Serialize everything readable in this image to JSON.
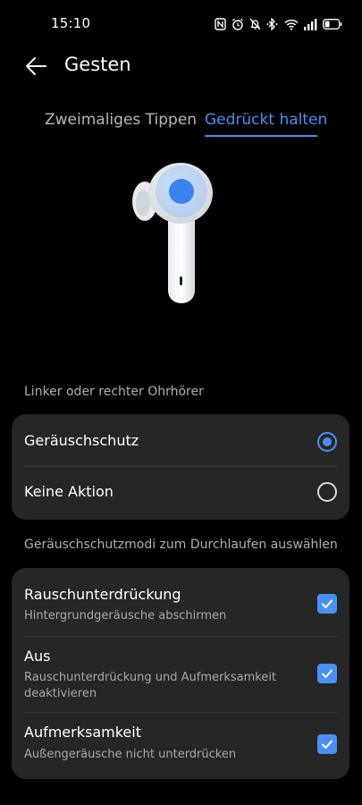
{
  "status_bar": {
    "time": "15:10",
    "icons": [
      "nfc-icon",
      "alarm-icon",
      "mute-icon",
      "bluetooth-icon",
      "wifi-icon",
      "signal-icon",
      "battery-icon"
    ]
  },
  "header": {
    "title": "Gesten",
    "back_icon": "arrow-left-icon"
  },
  "tabs": [
    {
      "label": "Zweimaliges Tippen",
      "selected": false
    },
    {
      "label": "Gedrückt halten",
      "selected": true
    }
  ],
  "earbud_section": {
    "label": "Linker oder rechter Ohrhörer",
    "options": [
      {
        "label": "Geräuschschutz",
        "selected": true
      },
      {
        "label": "Keine Aktion",
        "selected": false
      }
    ]
  },
  "modes_section": {
    "label": "Geräuschschutzmodi zum Durchlaufen auswählen",
    "items": [
      {
        "title": "Rauschunterdrückung",
        "subtitle": "Hintergrundgeräusche abschirmen",
        "checked": true
      },
      {
        "title": "Aus",
        "subtitle": "Rauschunterdrückung und Aufmerksamkeit deaktivieren",
        "checked": true
      },
      {
        "title": "Aufmerksamkeit",
        "subtitle": "Außengeräusche nicht unterdrücken",
        "checked": true
      }
    ]
  },
  "colors": {
    "accent": "#4a8ff5",
    "background": "#000000",
    "card": "#262626"
  }
}
